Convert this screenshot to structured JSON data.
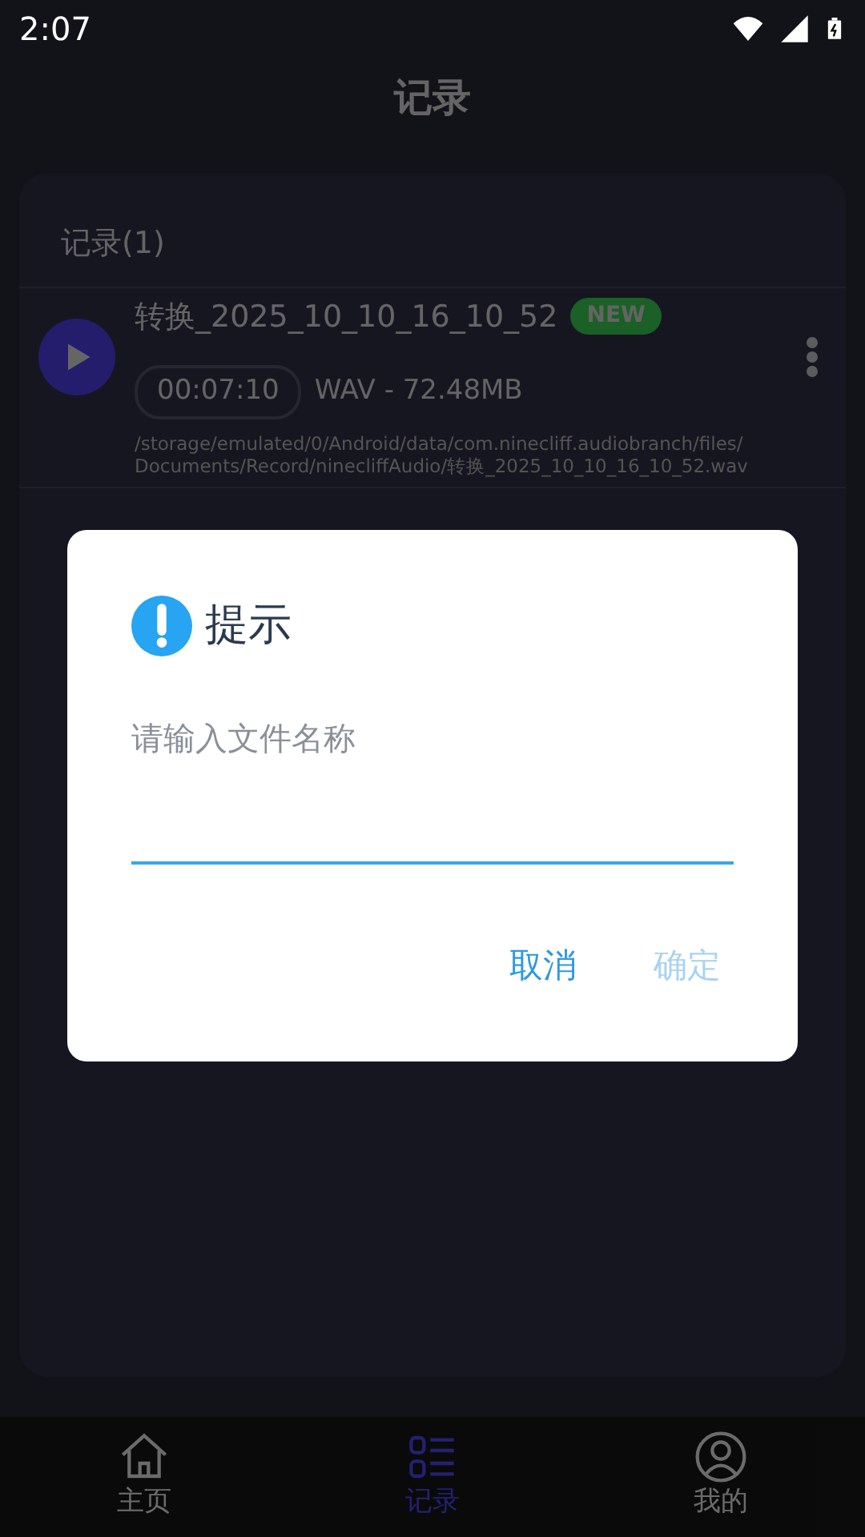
{
  "status_bar": {
    "time": "2:07"
  },
  "header": {
    "title": "记录"
  },
  "records": {
    "heading": "记录(1)",
    "items": [
      {
        "name": "转换_2025_10_10_16_10_52",
        "badge": "NEW",
        "duration": "00:07:10",
        "info": "WAV - 72.48MB",
        "path": "/storage/emulated/0/Android/data/com.ninecliff.audiobranch/files/\nDocuments/Record/ninecliffAudio/转换_2025_10_10_16_10_52.wav"
      }
    ]
  },
  "dialog": {
    "title": "提示",
    "message": "请输入文件名称",
    "buttons": [
      {
        "label": "取消",
        "disabled": false
      },
      {
        "label": "确定",
        "disabled": true
      }
    ]
  },
  "bottom_nav": [
    {
      "kind": "home",
      "label": "主页",
      "selected": false
    },
    {
      "kind": "list",
      "label": "记录",
      "selected": true
    },
    {
      "kind": "profile",
      "label": "我的",
      "selected": false
    }
  ]
}
